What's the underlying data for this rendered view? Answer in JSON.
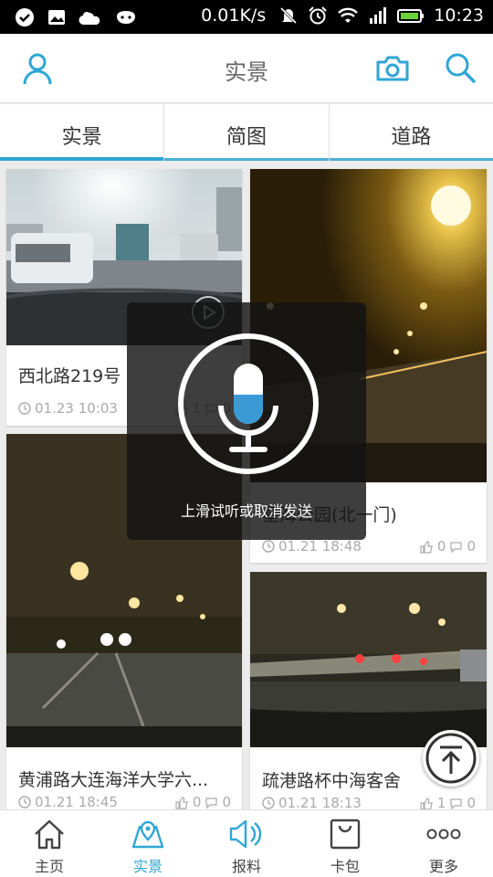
{
  "status_bar": {
    "speed": "0.01K/s",
    "time": "10:23"
  },
  "header": {
    "title": "实景"
  },
  "tabs": [
    {
      "label": "实景",
      "active": true
    },
    {
      "label": "简图",
      "active": false
    },
    {
      "label": "道路",
      "active": false
    }
  ],
  "cards": [
    {
      "title": "西北路219号",
      "time": "01.23 10:03",
      "likes": "1",
      "comments": "0"
    },
    {
      "title": "星海公园(北一门)",
      "time": "01.21 18:48",
      "likes": "0",
      "comments": "0"
    },
    {
      "title": "黄浦路大连海洋大学六...",
      "time": "01.21 18:45",
      "likes": "0",
      "comments": "0"
    },
    {
      "title": "疏港路杯中海客舍",
      "time": "01.21 18:13",
      "likes": "1",
      "comments": "0"
    }
  ],
  "voice_overlay": {
    "hint": "上滑试听或取消发送"
  },
  "bottom_nav": [
    {
      "label": "主页",
      "icon": "home-icon",
      "active": false
    },
    {
      "label": "实景",
      "icon": "map-pin-icon",
      "active": true
    },
    {
      "label": "报料",
      "icon": "speaker-icon",
      "active": false
    },
    {
      "label": "卡包",
      "icon": "bag-icon",
      "active": false
    },
    {
      "label": "更多",
      "icon": "more-icon",
      "active": false
    }
  ],
  "colors": {
    "accent": "#2fa6d6",
    "text": "#333333",
    "muted": "#aaaaaa"
  }
}
